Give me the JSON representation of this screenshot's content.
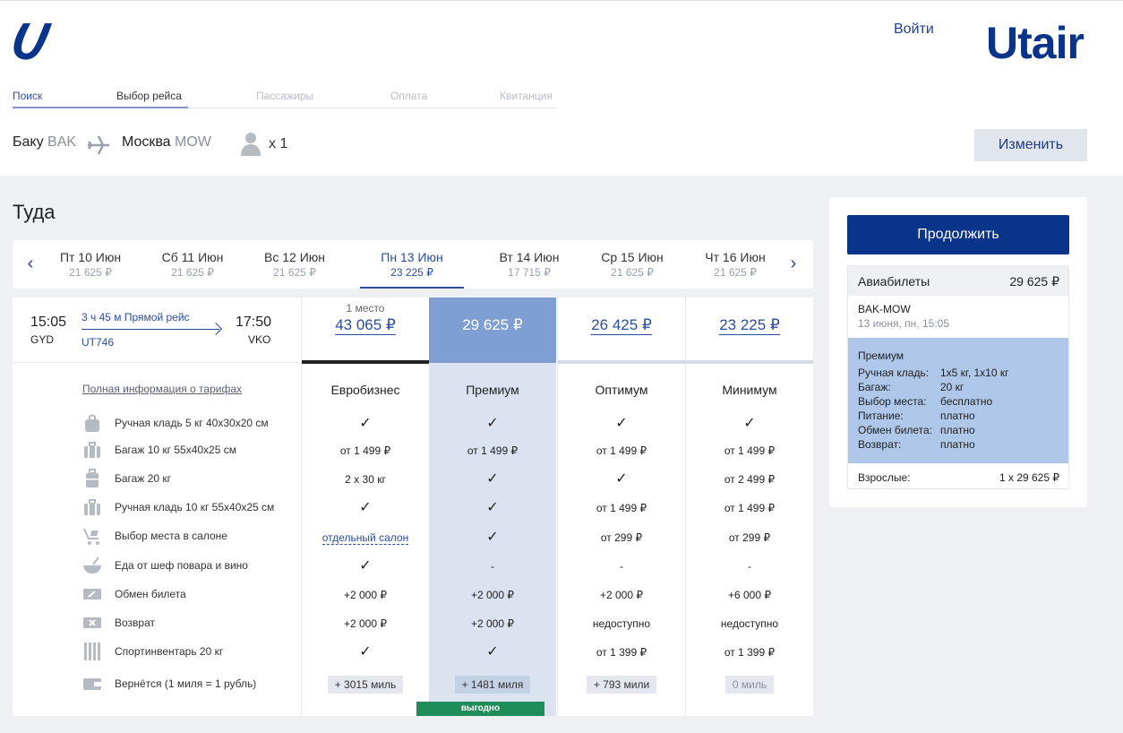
{
  "header": {
    "login": "Войти",
    "brand": "Utair"
  },
  "steps": [
    "Поиск",
    "Выбор рейса",
    "Пассажиры",
    "Оплата",
    "Квитанция"
  ],
  "route": {
    "from_city": "Баку",
    "from_code": "BAK",
    "to_city": "Москва",
    "to_code": "MOW",
    "passengers": "x 1",
    "change_label": "Изменить"
  },
  "title": "Туда",
  "dates": [
    {
      "day": "Пт 10 Июн",
      "price": "21 625 ₽"
    },
    {
      "day": "Сб 11 Июн",
      "price": "21 625 ₽"
    },
    {
      "day": "Вс 12 Июн",
      "price": "21 625 ₽"
    },
    {
      "day": "Пн 13 Июн",
      "price": "23 225 ₽"
    },
    {
      "day": "Вт 14 Июн",
      "price": "17 715 ₽"
    },
    {
      "day": "Ср 15 Июн",
      "price": "21 625 ₽"
    },
    {
      "day": "Чт 16 Июн",
      "price": "21 625 ₽"
    }
  ],
  "flight": {
    "dep_time": "15:05",
    "dep_code": "GYD",
    "arr_time": "17:50",
    "arr_code": "VKO",
    "duration": "3 ч 45 м  Прямой рейс",
    "flight_no": "UT746",
    "info_link": "Полная информация о тарифах"
  },
  "features": [
    "Ручная кладь 5 кг 40x30x20 см",
    "Багаж 10 кг 55x40x25 см",
    "Багаж 20 кг",
    "Ручная кладь 10 кг 55x40x25 см",
    "Выбор места в салоне",
    "Еда от шеф повара и вино",
    "Обмен билета",
    "Возврат",
    "Спортинвентарь 20 кг",
    "Вернётся (1 миля = 1 рубль)"
  ],
  "tariffs": [
    {
      "seats": "1 место",
      "price": "43 065 ₽",
      "name": "Евробизнес",
      "cells": [
        "✓",
        "от 1 499 ₽",
        "2 x 30 кг",
        "✓",
        "отдельный салон",
        "✓",
        "+2 000 ₽",
        "+2 000 ₽",
        "✓"
      ],
      "miles": "+ 3015 миль"
    },
    {
      "seats": "",
      "price": "29 625 ₽",
      "name": "Премиум",
      "cells": [
        "✓",
        "от 1 499 ₽",
        "✓",
        "✓",
        "✓",
        "-",
        "+2 000 ₽",
        "+2 000 ₽",
        "✓"
      ],
      "miles": "+ 1481 миля"
    },
    {
      "seats": "",
      "price": "26 425 ₽",
      "name": "Оптимум",
      "cells": [
        "✓",
        "от 1 499 ₽",
        "✓",
        "от 1 499 ₽",
        "от 299 ₽",
        "-",
        "+2 000 ₽",
        "недоступно",
        "от 1 399 ₽"
      ],
      "miles": "+ 793 мили"
    },
    {
      "seats": "",
      "price": "23 225 ₽",
      "name": "Минимум",
      "cells": [
        "✓",
        "от 1 499 ₽",
        "от 2 499 ₽",
        "от 1 499 ₽",
        "от 299 ₽",
        "-",
        "+6 000 ₽",
        "недоступно",
        "от 1 399 ₽"
      ],
      "miles": "0 миль"
    }
  ],
  "benefit_label": "выгодно",
  "sidebar": {
    "continue_label": "Продолжить",
    "tickets_label": "Авиабилеты",
    "tickets_price": "29 625 ₽",
    "route": "BAK-MOW",
    "date": "13 июня, пн, 15:05",
    "tariff_name": "Премиум",
    "rows": [
      {
        "k": "Ручная кладь:",
        "v": "1x5 кг, 1x10 кг"
      },
      {
        "k": "Багаж:",
        "v": "20 кг"
      },
      {
        "k": "Выбор места:",
        "v": "бесплатно"
      },
      {
        "k": "Питание:",
        "v": "платно"
      },
      {
        "k": "Обмен билета:",
        "v": "платно"
      },
      {
        "k": "Возврат:",
        "v": "платно"
      }
    ],
    "adults_label": "Взрослые:",
    "adults_value": "1 x 29 625 ₽"
  },
  "colors": {
    "brand": "#0a3489",
    "premium_header": "#7f9fd2",
    "premium_col": "#dbe3f0",
    "benefit": "#1f8d5a"
  }
}
